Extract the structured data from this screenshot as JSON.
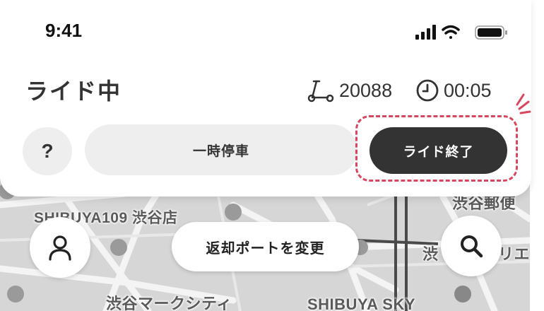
{
  "status_bar": {
    "time": "9:41",
    "icons": [
      "signal-icon",
      "wifi-icon",
      "battery-icon"
    ]
  },
  "header": {
    "title": "ライド中",
    "vehicle_id": "20088",
    "elapsed_time": "00:05"
  },
  "actions": {
    "help_label": "?",
    "pause_label": "一時停車",
    "end_ride_label": "ライド終了"
  },
  "map": {
    "labels": [
      "SHIBUYA109 渋谷店",
      "渋谷郵便",
      "渋谷マークシティ",
      "SHIBUYA SKY",
      "渋",
      "リエ"
    ],
    "change_port_label": "返却ポートを変更"
  },
  "colors": {
    "highlight": "#d6475f",
    "end_button": "#333333",
    "secondary_button": "#eeeeee"
  }
}
